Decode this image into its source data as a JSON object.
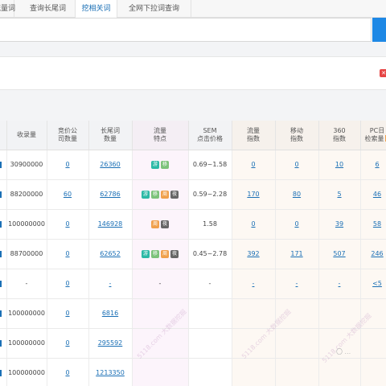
{
  "tabs": [
    {
      "label": "流量词",
      "active": false
    },
    {
      "label": "查询长尾词",
      "active": false
    },
    {
      "label": "挖相关词",
      "active": true
    },
    {
      "label": "全网下拉词查询",
      "active": false
    }
  ],
  "corner_icon_text": "✕",
  "table": {
    "headers": [
      "收录量",
      "竞价公司数量",
      "长尾词数量",
      "流量特点",
      "SEM点击价格",
      "流量指数",
      "移动指数",
      "360指数",
      "PC日检索量"
    ],
    "header_lines": [
      [
        "收录量"
      ],
      [
        "竞价公",
        "司数量"
      ],
      [
        "长尾词",
        "数量"
      ],
      [
        "流量",
        "特点"
      ],
      [
        "SEM",
        "点击价格"
      ],
      [
        "流量",
        "指数"
      ],
      [
        "移动",
        "指数"
      ],
      [
        "360",
        "指数"
      ],
      [
        "PC日",
        "检索量"
      ]
    ],
    "rows": [
      {
        "shoulu": "30900000",
        "jingjia": "0",
        "changwei": "26360",
        "badges": [
          "游",
          "移"
        ],
        "sem": "0.69~1.58",
        "liuliang": "0",
        "yidong": "0",
        "s360": "10",
        "pc": "6"
      },
      {
        "shoulu": "88200000",
        "jingjia": "60",
        "changwei": "62786",
        "badges": [
          "游",
          "移",
          "周",
          "夜"
        ],
        "sem": "0.59~2.28",
        "liuliang": "170",
        "yidong": "80",
        "s360": "5",
        "pc": "46"
      },
      {
        "shoulu": "100000000",
        "jingjia": "0",
        "changwei": "146928",
        "badges": [
          "周",
          "夜"
        ],
        "sem": "1.58",
        "liuliang": "0",
        "yidong": "0",
        "s360": "39",
        "pc": "58"
      },
      {
        "shoulu": "88700000",
        "jingjia": "0",
        "changwei": "62652",
        "badges": [
          "游",
          "移",
          "周",
          "夜"
        ],
        "sem": "0.45~2.78",
        "liuliang": "392",
        "yidong": "171",
        "s360": "507",
        "pc": "246"
      },
      {
        "shoulu": "-",
        "jingjia": "0",
        "changwei": "-",
        "badges": [
          "-"
        ],
        "sem": "-",
        "liuliang": "-",
        "yidong": "-",
        "s360": "-",
        "pc": "<5"
      },
      {
        "shoulu": "100000000",
        "jingjia": "0",
        "changwei": "6816",
        "badges": [],
        "sem": "",
        "liuliang": "",
        "yidong": "",
        "s360": "",
        "pc": ""
      },
      {
        "shoulu": "100000000",
        "jingjia": "0",
        "changwei": "295592",
        "badges": [],
        "sem": "",
        "liuliang": "",
        "yidong": "",
        "s360": "",
        "pc": ""
      },
      {
        "shoulu": "100000000",
        "jingjia": "0",
        "changwei": "1213350",
        "badges": [],
        "sem": "",
        "liuliang": "",
        "yidong": "",
        "s360": "",
        "pc": ""
      }
    ]
  },
  "watermarks": [
    "5118.com 大数据挖掘",
    "5118.com 大数据挖掘",
    "5118.com 大数据挖掘"
  ],
  "wechat_text": "〇 ..."
}
